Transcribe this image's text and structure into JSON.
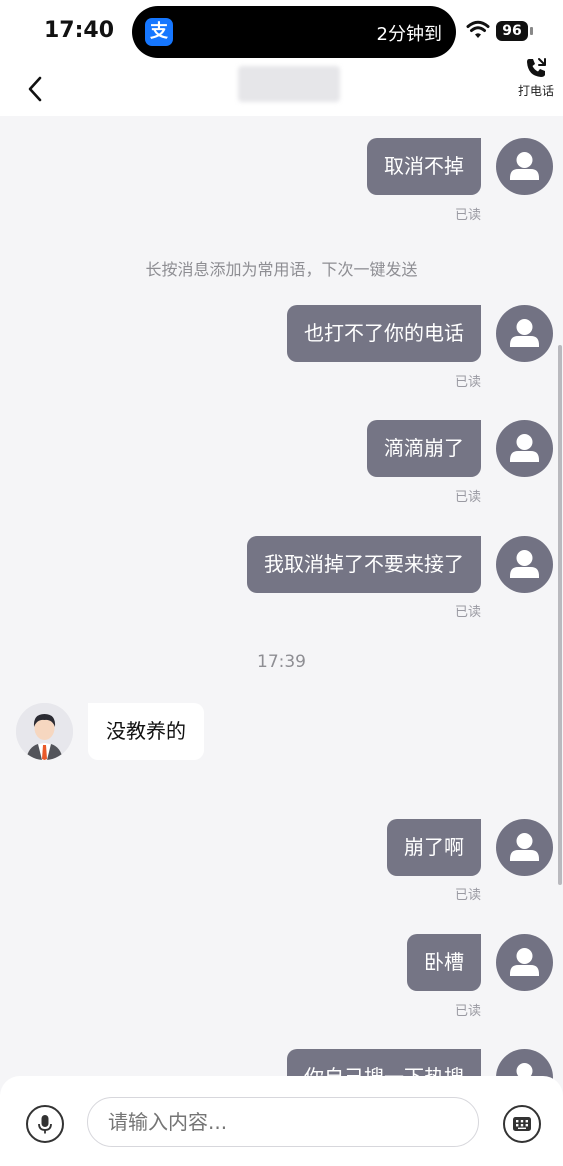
{
  "status_bar": {
    "time": "17:40",
    "app_icon_glyph": "支",
    "island_text": "2分钟到",
    "battery": "96"
  },
  "nav": {
    "title": "",
    "call_label": "打电话"
  },
  "chat": {
    "messages": [
      {
        "text": "取消不掉",
        "read": "已读"
      },
      {
        "text": "也打不了你的电话",
        "read": "已读"
      },
      {
        "text": "滴滴崩了",
        "read": "已读"
      },
      {
        "text": "我取消掉了不要来接了",
        "read": "已读"
      },
      {
        "text": "崩了啊",
        "read": "已读"
      },
      {
        "text": "卧槽",
        "read": "已读"
      },
      {
        "text": "你自己搜一下热搜"
      }
    ],
    "hint": "长按消息添加为常用语，下次一键发送",
    "time_separator": "17:39",
    "incoming": {
      "text": "没教养的"
    }
  },
  "input": {
    "placeholder": "请输入内容..."
  }
}
